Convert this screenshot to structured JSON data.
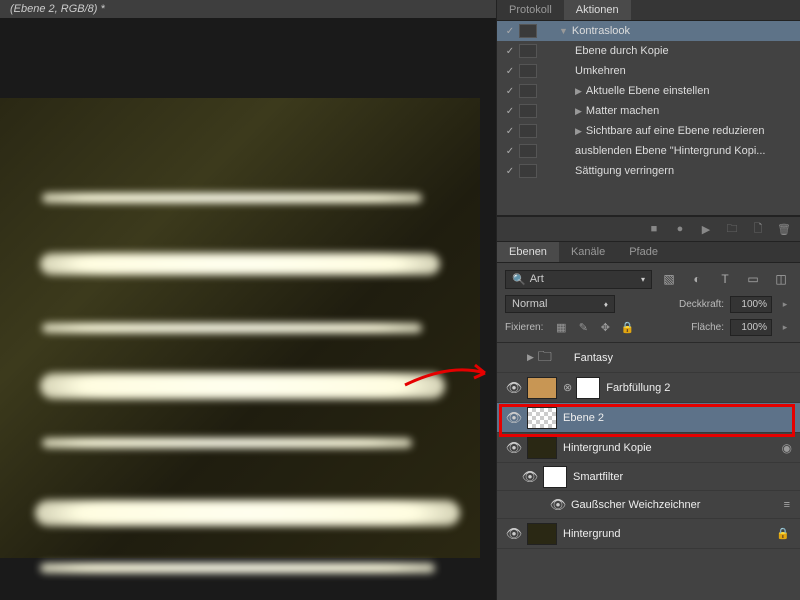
{
  "titlebar": "(Ebene 2, RGB/8) *",
  "tabs_top": {
    "protokoll": "Protokoll",
    "aktionen": "Aktionen"
  },
  "actions": [
    {
      "label": "Kontraslook",
      "indent": 1,
      "tri": "▼",
      "selected": true
    },
    {
      "label": "Ebene durch Kopie",
      "indent": 2
    },
    {
      "label": "Umkehren",
      "indent": 2
    },
    {
      "label": "Aktuelle Ebene einstellen",
      "indent": 2,
      "tri": "▶"
    },
    {
      "label": "Matter machen",
      "indent": 2,
      "tri": "▶"
    },
    {
      "label": "Sichtbare auf eine Ebene reduzieren",
      "indent": 2,
      "tri": "▶"
    },
    {
      "label": "ausblenden Ebene \"Hintergrund Kopi...",
      "indent": 2
    },
    {
      "label": "Sättigung verringern",
      "indent": 2
    }
  ],
  "tabs_layers": {
    "ebenen": "Ebenen",
    "kanale": "Kanäle",
    "pfade": "Pfade"
  },
  "filter_kind": "Art",
  "blend_mode": "Normal",
  "opacity": {
    "label": "Deckkraft:",
    "value": "100%"
  },
  "fill": {
    "label": "Fläche:",
    "value": "100%"
  },
  "lock_label": "Fixieren:",
  "layers": {
    "fantasy": "Fantasy",
    "farbfullung": "Farbfüllung 2",
    "ebene2": "Ebene 2",
    "hgkopie": "Hintergrund Kopie",
    "smartfilter": "Smartfilter",
    "gauss": "Gaußscher Weichzeichner",
    "hintergrund": "Hintergrund"
  },
  "search_icon": "🔍"
}
